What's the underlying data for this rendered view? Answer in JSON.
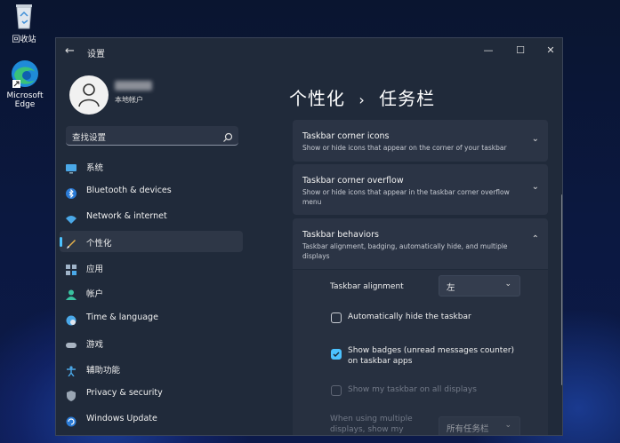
{
  "desktop": {
    "recycle_bin": "回收站",
    "edge_line1": "Microsoft",
    "edge_line2": "Edge"
  },
  "window": {
    "title": "设置",
    "controls": {
      "minimize": "—",
      "maximize": "☐",
      "close": "✕"
    }
  },
  "account": {
    "label": "本地帐户"
  },
  "search": {
    "placeholder": "查找设置"
  },
  "nav": {
    "items": [
      {
        "label": "系统",
        "icon": "monitor-icon"
      },
      {
        "label": "Bluetooth & devices",
        "icon": "bluetooth-icon"
      },
      {
        "label": "Network & internet",
        "icon": "wifi-icon"
      },
      {
        "label": "个性化",
        "icon": "brush-icon"
      },
      {
        "label": "应用",
        "icon": "apps-icon"
      },
      {
        "label": "帐户",
        "icon": "person-icon"
      },
      {
        "label": "Time & language",
        "icon": "globe-clock-icon"
      },
      {
        "label": "游戏",
        "icon": "gamepad-icon"
      },
      {
        "label": "辅助功能",
        "icon": "accessibility-icon"
      },
      {
        "label": "Privacy & security",
        "icon": "shield-icon"
      },
      {
        "label": "Windows Update",
        "icon": "update-icon"
      }
    ],
    "active_index": 3
  },
  "breadcrumb": {
    "parent": "个性化",
    "separator": "›",
    "current": "任务栏"
  },
  "sections": {
    "corner_icons": {
      "title": "Taskbar corner icons",
      "desc": "Show or hide icons that appear on the corner of your taskbar"
    },
    "corner_overflow": {
      "title": "Taskbar corner overflow",
      "desc": "Show or hide icons that appear in the taskbar corner overflow menu"
    },
    "behaviors": {
      "title": "Taskbar behaviors",
      "desc": "Taskbar alignment, badging, automatically hide, and multiple displays",
      "alignment_label": "Taskbar alignment",
      "alignment_value": "左",
      "auto_hide": {
        "label": "Automatically hide the taskbar",
        "checked": false
      },
      "badges": {
        "label": "Show badges (unread messages counter) on taskbar apps",
        "checked": true
      },
      "all_displays": {
        "label": "Show my taskbar on all displays",
        "checked": false,
        "disabled": true
      },
      "multi_display_label": "When using multiple displays, show my",
      "multi_display_value": "所有任务栏"
    }
  },
  "colors": {
    "accent": "#4cc2ff",
    "window_bg": "#202a3a",
    "card_bg": "#2b3445"
  }
}
